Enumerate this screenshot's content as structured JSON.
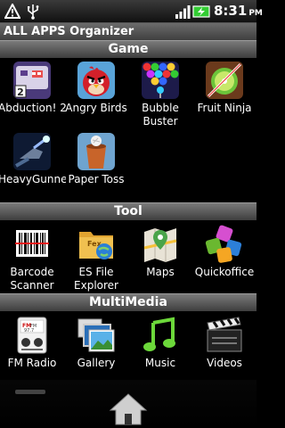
{
  "status_bar": {
    "time": "8:31",
    "ampm": "PM"
  },
  "app_title": "ALL APPS Organizer",
  "sections": [
    {
      "title": "Game",
      "apps": [
        {
          "label": "Abduction! 2",
          "icon": "abduction-icon"
        },
        {
          "label": "Angry Birds",
          "icon": "angry-birds-icon"
        },
        {
          "label": "Bubble Buster",
          "icon": "bubble-buster-icon"
        },
        {
          "label": "Fruit Ninja",
          "icon": "fruit-ninja-icon"
        },
        {
          "label": "HeavyGunner",
          "icon": "heavygunner-icon"
        },
        {
          "label": "Paper Toss",
          "icon": "paper-toss-icon"
        }
      ]
    },
    {
      "title": "Tool",
      "apps": [
        {
          "label": "Barcode Scanner",
          "icon": "barcode-scanner-icon"
        },
        {
          "label": "ES File Explorer",
          "icon": "es-file-explorer-icon"
        },
        {
          "label": "Maps",
          "icon": "maps-icon"
        },
        {
          "label": "Quickoffice",
          "icon": "quickoffice-icon"
        }
      ]
    },
    {
      "title": "MultiMedia",
      "apps": [
        {
          "label": "FM Radio",
          "icon": "fm-radio-icon"
        },
        {
          "label": "Gallery",
          "icon": "gallery-icon"
        },
        {
          "label": "Music",
          "icon": "music-icon"
        },
        {
          "label": "Videos",
          "icon": "videos-icon"
        }
      ]
    }
  ],
  "fm_radio_icon_text": [
    "FM",
    "FM",
    "97.7"
  ]
}
